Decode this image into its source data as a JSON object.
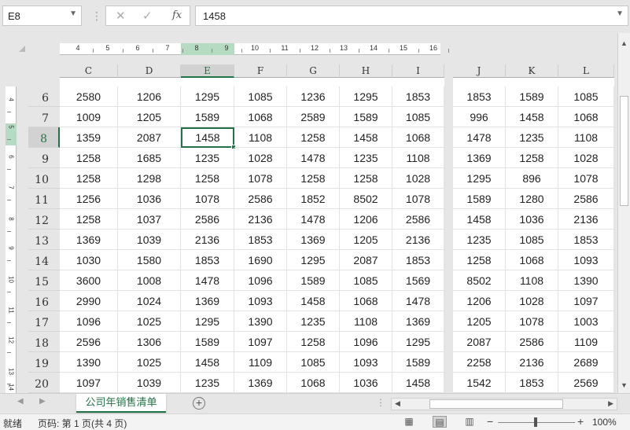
{
  "formula_bar": {
    "name_box": "E8",
    "cancel_icon": "✕",
    "enter_icon": "✓",
    "fx_label": "fx",
    "formula_value": "1458"
  },
  "ruler": {
    "h_numbers": [
      "4",
      "5",
      "6",
      "7",
      "8",
      "9",
      "10",
      "11",
      "12",
      "13",
      "14",
      "15",
      "16"
    ],
    "v_numbers": [
      "4",
      "5",
      "6",
      "7",
      "8",
      "9",
      "10",
      "11",
      "12",
      "13",
      "14"
    ]
  },
  "columns": [
    "C",
    "D",
    "E",
    "F",
    "G",
    "H",
    "I",
    "J",
    "K",
    "L"
  ],
  "selected_column": "E",
  "rows": [
    "6",
    "7",
    "8",
    "9",
    "10",
    "11",
    "12",
    "13",
    "14",
    "15",
    "16",
    "17",
    "18",
    "19",
    "20"
  ],
  "selected_row": "8",
  "cells": [
    [
      "2580",
      "1206",
      "1295",
      "1085",
      "1236",
      "1295",
      "1853",
      "1853",
      "1589",
      "1085"
    ],
    [
      "1009",
      "1205",
      "1589",
      "1068",
      "2589",
      "1589",
      "1085",
      "996",
      "1458",
      "1068"
    ],
    [
      "1359",
      "2087",
      "1458",
      "1108",
      "1258",
      "1458",
      "1068",
      "1478",
      "1235",
      "1108"
    ],
    [
      "1258",
      "1685",
      "1235",
      "1028",
      "1478",
      "1235",
      "1108",
      "1369",
      "1258",
      "1028"
    ],
    [
      "1258",
      "1298",
      "1258",
      "1078",
      "1258",
      "1258",
      "1028",
      "1295",
      "896",
      "1078"
    ],
    [
      "1256",
      "1036",
      "1078",
      "2586",
      "1852",
      "8502",
      "1078",
      "1589",
      "1280",
      "2586"
    ],
    [
      "1258",
      "1037",
      "2586",
      "2136",
      "1478",
      "1206",
      "2586",
      "1458",
      "1036",
      "2136"
    ],
    [
      "1369",
      "1039",
      "2136",
      "1853",
      "1369",
      "1205",
      "2136",
      "1235",
      "1085",
      "1853"
    ],
    [
      "1030",
      "1580",
      "1853",
      "1690",
      "1295",
      "2087",
      "1853",
      "1258",
      "1068",
      "1093"
    ],
    [
      "3600",
      "1008",
      "1478",
      "1096",
      "1589",
      "1085",
      "1569",
      "8502",
      "1108",
      "1390"
    ],
    [
      "2990",
      "1024",
      "1369",
      "1093",
      "1458",
      "1068",
      "1478",
      "1206",
      "1028",
      "1097"
    ],
    [
      "1096",
      "1025",
      "1295",
      "1390",
      "1235",
      "1108",
      "1369",
      "1205",
      "1078",
      "1003"
    ],
    [
      "2596",
      "1306",
      "1589",
      "1097",
      "1258",
      "1096",
      "1295",
      "2087",
      "2586",
      "1109"
    ],
    [
      "1390",
      "1025",
      "1458",
      "1109",
      "1085",
      "1093",
      "1589",
      "2258",
      "2136",
      "2689"
    ],
    [
      "1097",
      "1039",
      "1235",
      "1369",
      "1068",
      "1036",
      "1458",
      "1542",
      "1853",
      "2569"
    ]
  ],
  "sheet_tabs": [
    "公司年销售清单"
  ],
  "add_sheet_icon": "+",
  "status": {
    "ready": "就绪",
    "page_info": "页码: 第 1 页(共 4 页)",
    "zoom": "100%",
    "zoom_minus": "−",
    "zoom_plus": "+"
  },
  "colors": {
    "accent": "#217346",
    "ruler_highlight": "#b5dcc2"
  }
}
